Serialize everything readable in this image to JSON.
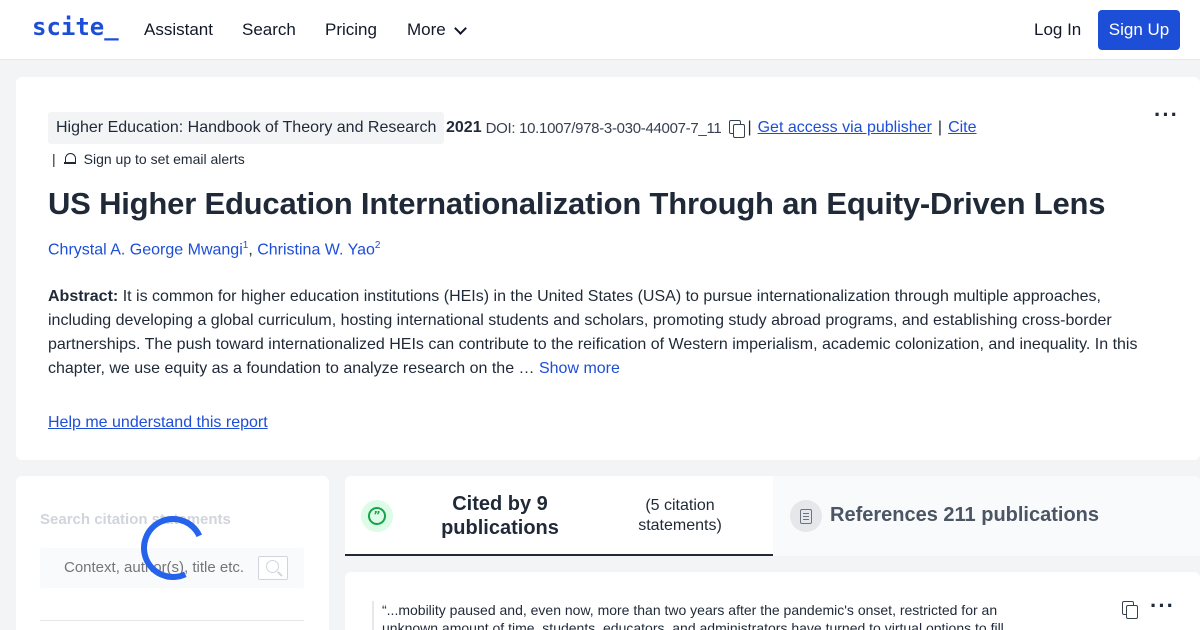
{
  "nav": {
    "logo": "scite_",
    "links": [
      "Assistant",
      "Search",
      "Pricing",
      "More"
    ],
    "login": "Log In",
    "signup": "Sign Up"
  },
  "paper": {
    "journal": "Higher Education: Handbook of Theory and Research",
    "year": "2021",
    "doi": "DOI: 10.1007/978-3-030-44007-7_11",
    "access_link": "Get access via publisher",
    "cite_link": "Cite",
    "alert_text": "Sign up to set email alerts",
    "title": "US Higher Education Internationalization Through an Equity-Driven Lens",
    "authors": [
      {
        "name": "Chrystal A. George Mwangi",
        "sup": "1"
      },
      {
        "name": "Christina W. Yao",
        "sup": "2"
      }
    ],
    "abstract_label": "Abstract:",
    "abstract_text": "It is common for higher education institutions (HEIs) in the United States (USA) to pursue internationalization through multiple approaches, including developing a global curriculum, hosting international students and scholars, promoting study abroad programs, and establishing cross-border partnerships. The push toward internationalized HEIs can contribute to the reification of Western imperialism, academic colonization, and inequality. In this chapter, we use equity as a foundation to analyze research on the …",
    "show_more": "Show more",
    "help_link": "Help me understand this report"
  },
  "citations_search": {
    "label": "Search citation statements",
    "placeholder": "Context, author(s), title etc."
  },
  "tabs": {
    "cited_by": "Cited by 9 publications",
    "citation_statements": "(5 citation statements)",
    "references": "References 211 publications"
  },
  "citation": {
    "text": "“...mobility paused and, even now, more than two years after the pandemic's onset, restricted for an unknown amount of time, students, educators, and administrators have turned to virtual options to fill"
  },
  "colors": {
    "brand": "#1d4ed8",
    "spinner": "#2563eb",
    "cited_green": "#16a34a"
  },
  "icons": [
    "chevron-down-icon",
    "copy-icon",
    "bell-icon",
    "more-options-icon",
    "search-icon",
    "loading-spinner",
    "quote-icon",
    "document-icon"
  ]
}
